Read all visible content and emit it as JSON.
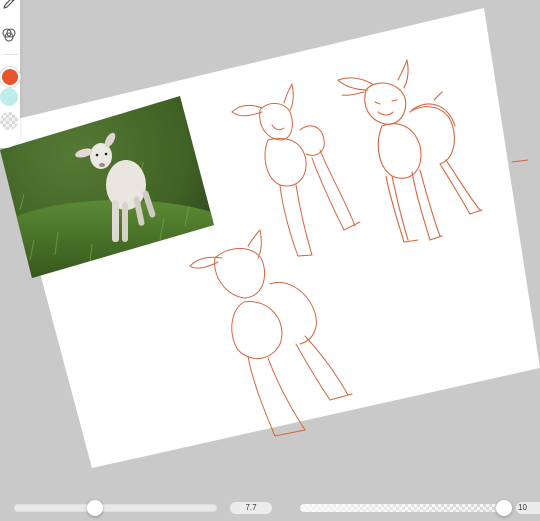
{
  "toolbar": {
    "tools": [
      {
        "name": "pencil-icon"
      },
      {
        "name": "blend-icon"
      }
    ],
    "colors": {
      "primary": "#e8542c",
      "secondary": "#bfeeea",
      "transparent": "transparent"
    }
  },
  "canvas": {
    "page_color": "#ffffff",
    "stroke_color": "#d4663f",
    "reference_photo": {
      "grass_dark": "#2f4d1f",
      "grass_light": "#6f9a3f",
      "lamb_wool": "#e6e3dd"
    }
  },
  "sliders": {
    "brush_size": {
      "value_label": "7.7",
      "fraction": 0.4
    },
    "opacity": {
      "value_label": "10",
      "fraction": 0.98
    }
  }
}
